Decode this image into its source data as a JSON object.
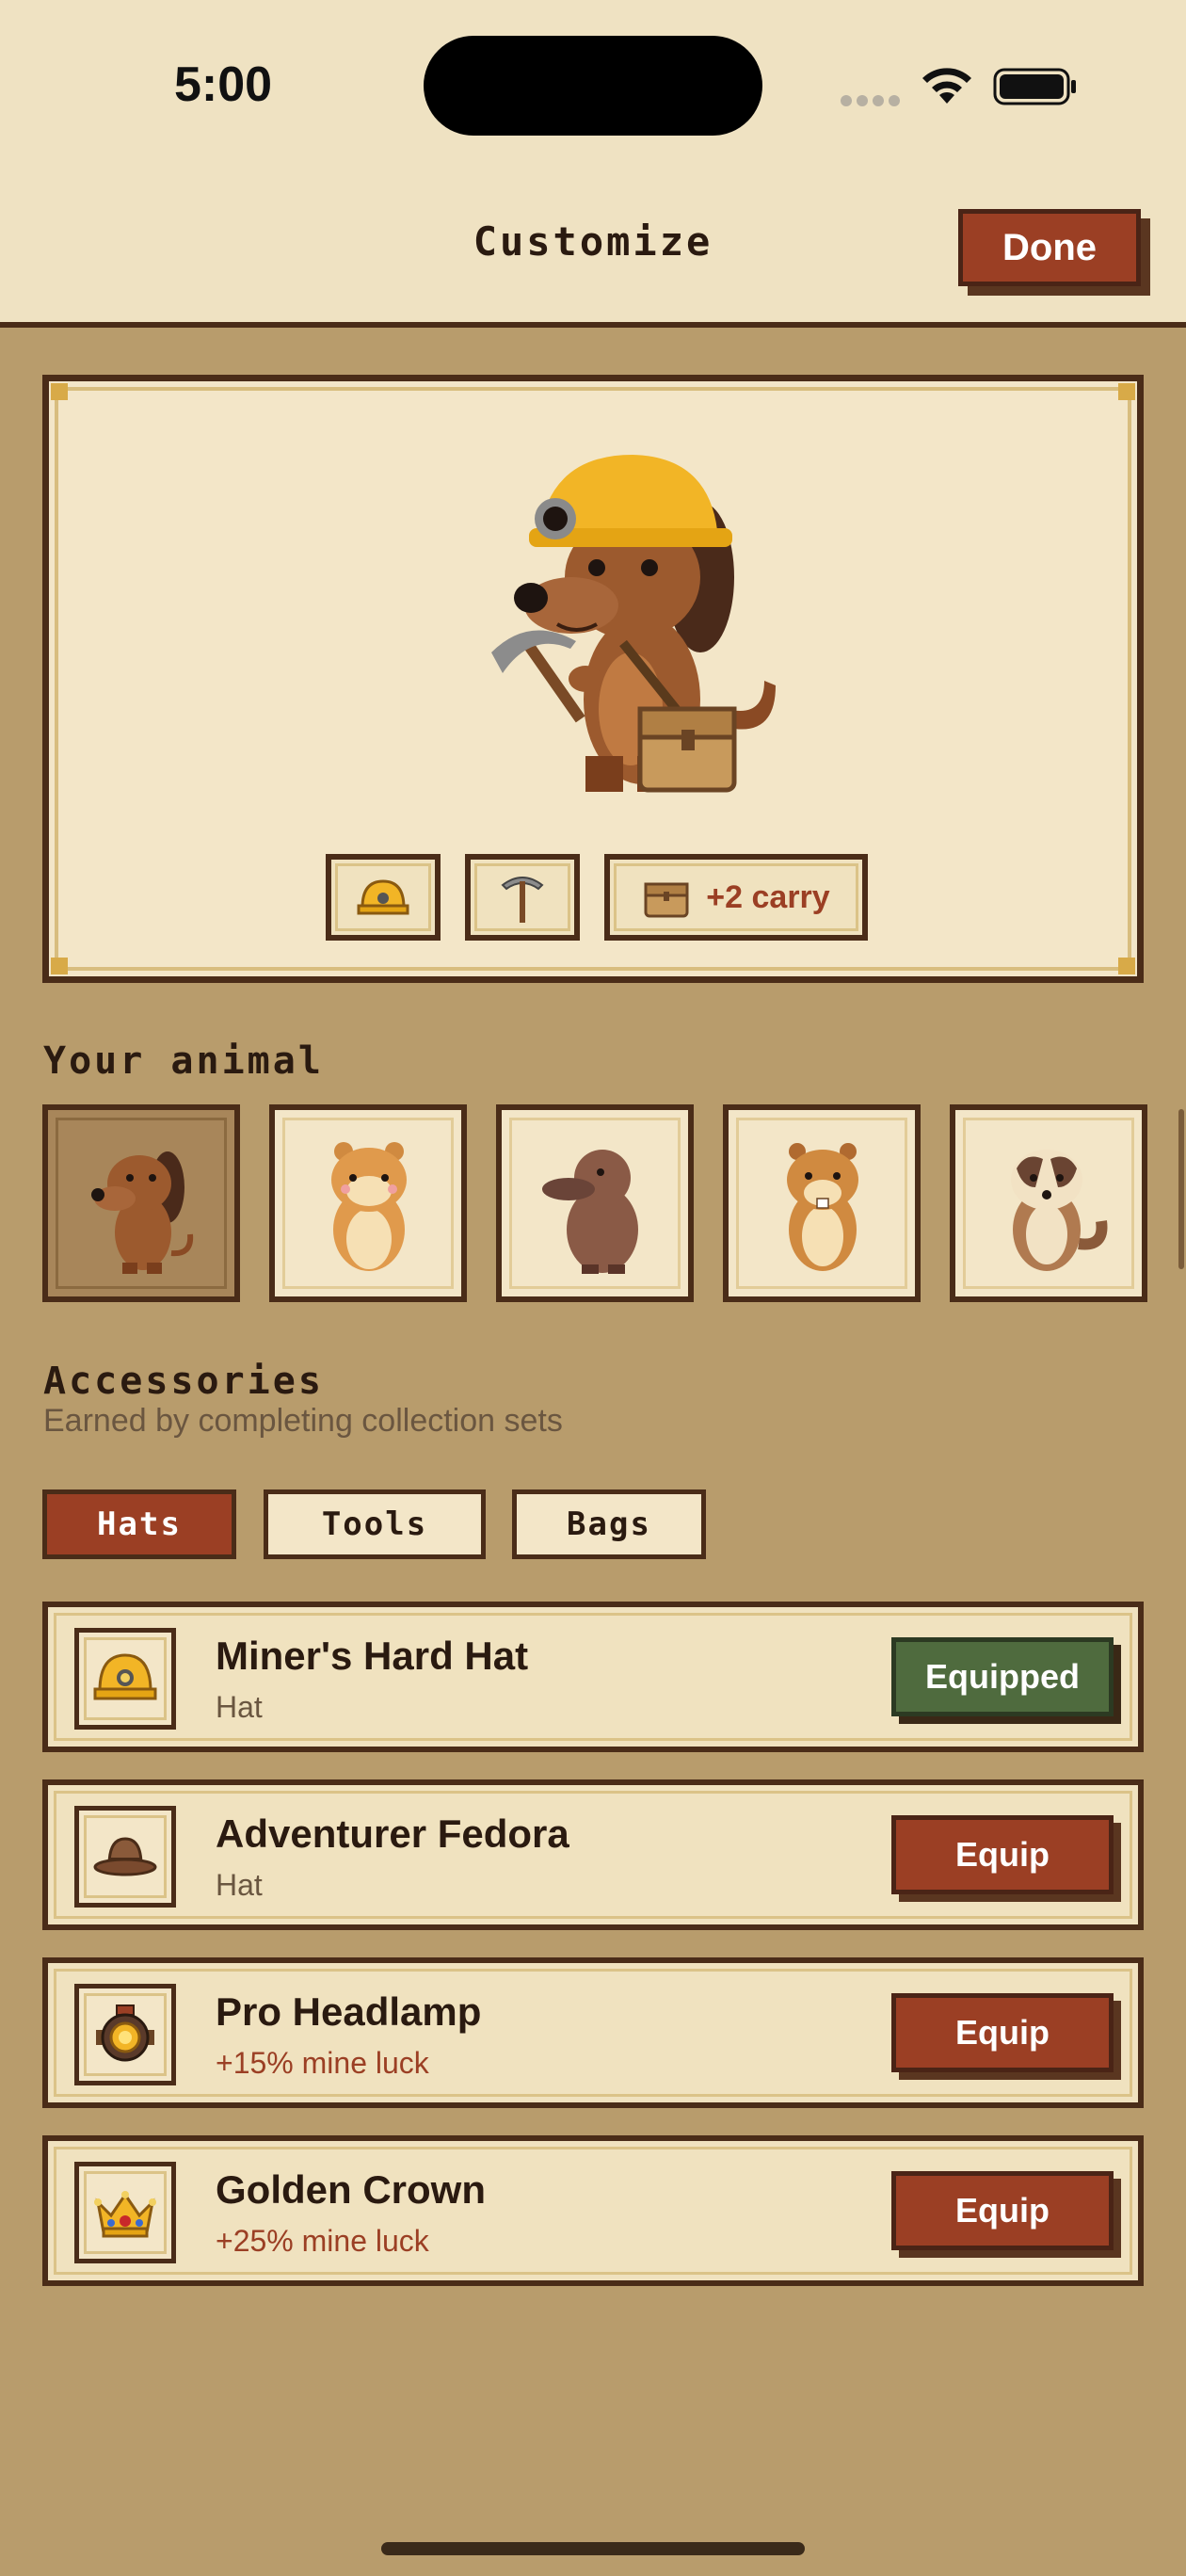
{
  "status_bar": {
    "time": "5:00"
  },
  "header": {
    "title": "Customize",
    "done_label": "Done"
  },
  "preview": {
    "equipped": [
      {
        "icon": "hard-hat-icon"
      },
      {
        "icon": "pickaxe-icon"
      },
      {
        "icon": "bag-icon",
        "label": "+2 carry"
      }
    ]
  },
  "animals": {
    "title": "Your animal",
    "items": [
      {
        "name": "dog-icon",
        "selected": true
      },
      {
        "name": "hamster-icon",
        "selected": false
      },
      {
        "name": "platypus-icon",
        "selected": false
      },
      {
        "name": "beaver-icon",
        "selected": false
      },
      {
        "name": "badger-icon",
        "selected": false
      }
    ]
  },
  "accessories": {
    "title": "Accessories",
    "subtitle": "Earned by completing collection sets",
    "tabs": [
      "Hats",
      "Tools",
      "Bags"
    ],
    "active_tab": "Hats",
    "items": [
      {
        "name": "Miner's Hard Hat",
        "sub": "Hat",
        "button": "Equipped",
        "equipped": true,
        "icon": "hard-hat-icon"
      },
      {
        "name": "Adventurer Fedora",
        "sub": "Hat",
        "button": "Equip",
        "equipped": false,
        "icon": "fedora-icon"
      },
      {
        "name": "Pro Headlamp",
        "sub": "+15% mine luck",
        "button": "Equip",
        "equipped": false,
        "icon": "headlamp-icon"
      },
      {
        "name": "Golden Crown",
        "sub": "+25% mine luck",
        "button": "Equip",
        "equipped": false,
        "icon": "crown-icon"
      }
    ]
  },
  "colors": {
    "background": "#b89c6c",
    "panel": "#efe2c2",
    "border": "#4a2c18",
    "accent_red": "#9b3f24",
    "equipped_green": "#4f6b3e"
  }
}
